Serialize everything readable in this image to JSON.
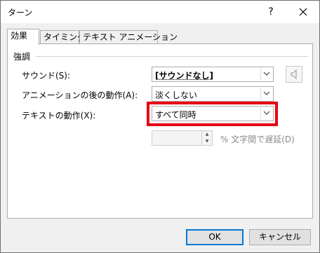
{
  "window": {
    "title": "ターン",
    "help_label": "?"
  },
  "tabs": [
    {
      "label": "効果",
      "active": true
    },
    {
      "label": "タイミング",
      "active": false
    },
    {
      "label": "テキスト アニメーション",
      "active": false
    }
  ],
  "group": {
    "label": "強調"
  },
  "sound": {
    "label": "サウンド(S):",
    "value": "[サウンドなし]"
  },
  "after_animation": {
    "label": "アニメーションの後の動作(A):",
    "value": "淡くしない"
  },
  "text_animation": {
    "label": "テキストの動作(X):",
    "value": "すべて同時"
  },
  "delay": {
    "value": "",
    "label": "% 文字間で遅延(D)"
  },
  "buttons": {
    "ok": "OK",
    "cancel": "キャンセル"
  },
  "colors": {
    "highlight": "#e60012",
    "accent": "#0078d7"
  }
}
